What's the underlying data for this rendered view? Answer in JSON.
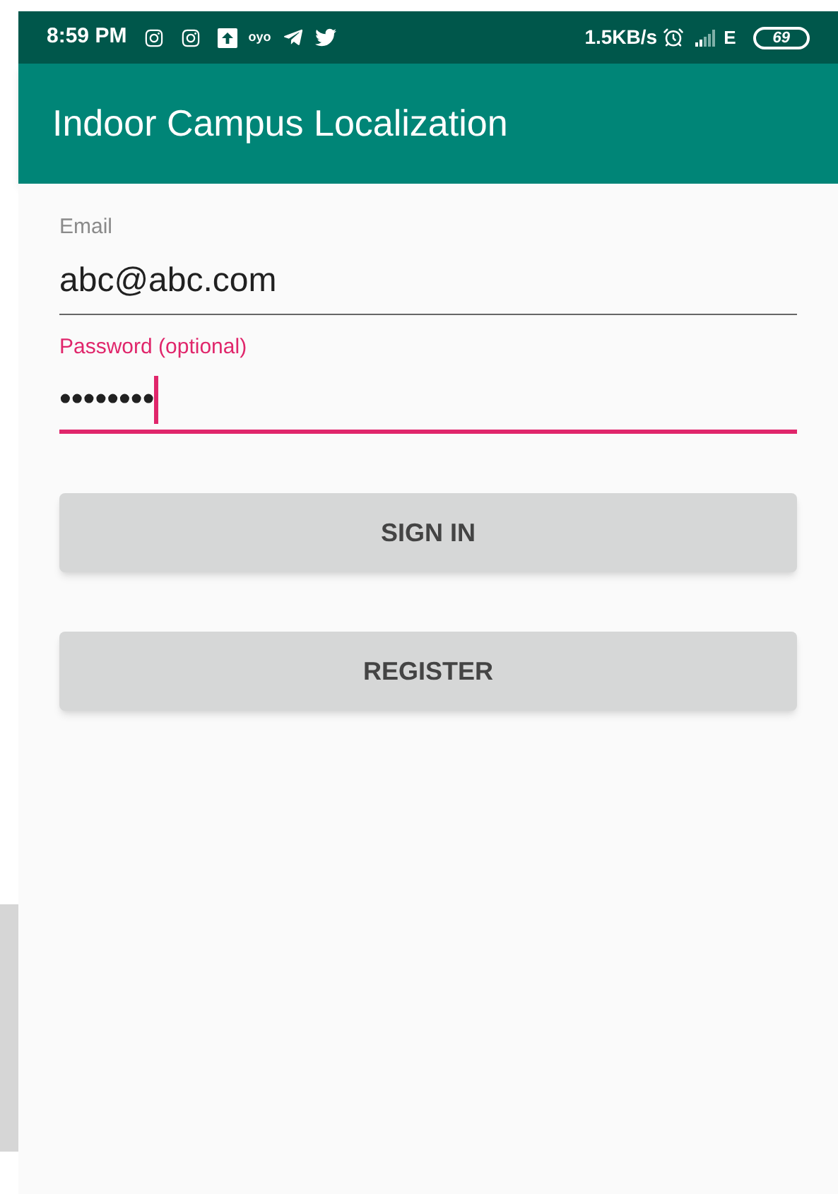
{
  "status_bar": {
    "time": "8:59 PM",
    "notification_text": "oyo",
    "network_speed": "1.5KB/s",
    "network_type": "E",
    "battery": "69"
  },
  "app_bar": {
    "title": "Indoor Campus Localization"
  },
  "fields": [
    {
      "label": "Email",
      "value": "abc@abc.com",
      "focused": false
    },
    {
      "label": "Password (optional)",
      "value": "••••••••",
      "focused": true
    }
  ],
  "buttons": [
    "SIGN IN",
    "REGISTER"
  ]
}
